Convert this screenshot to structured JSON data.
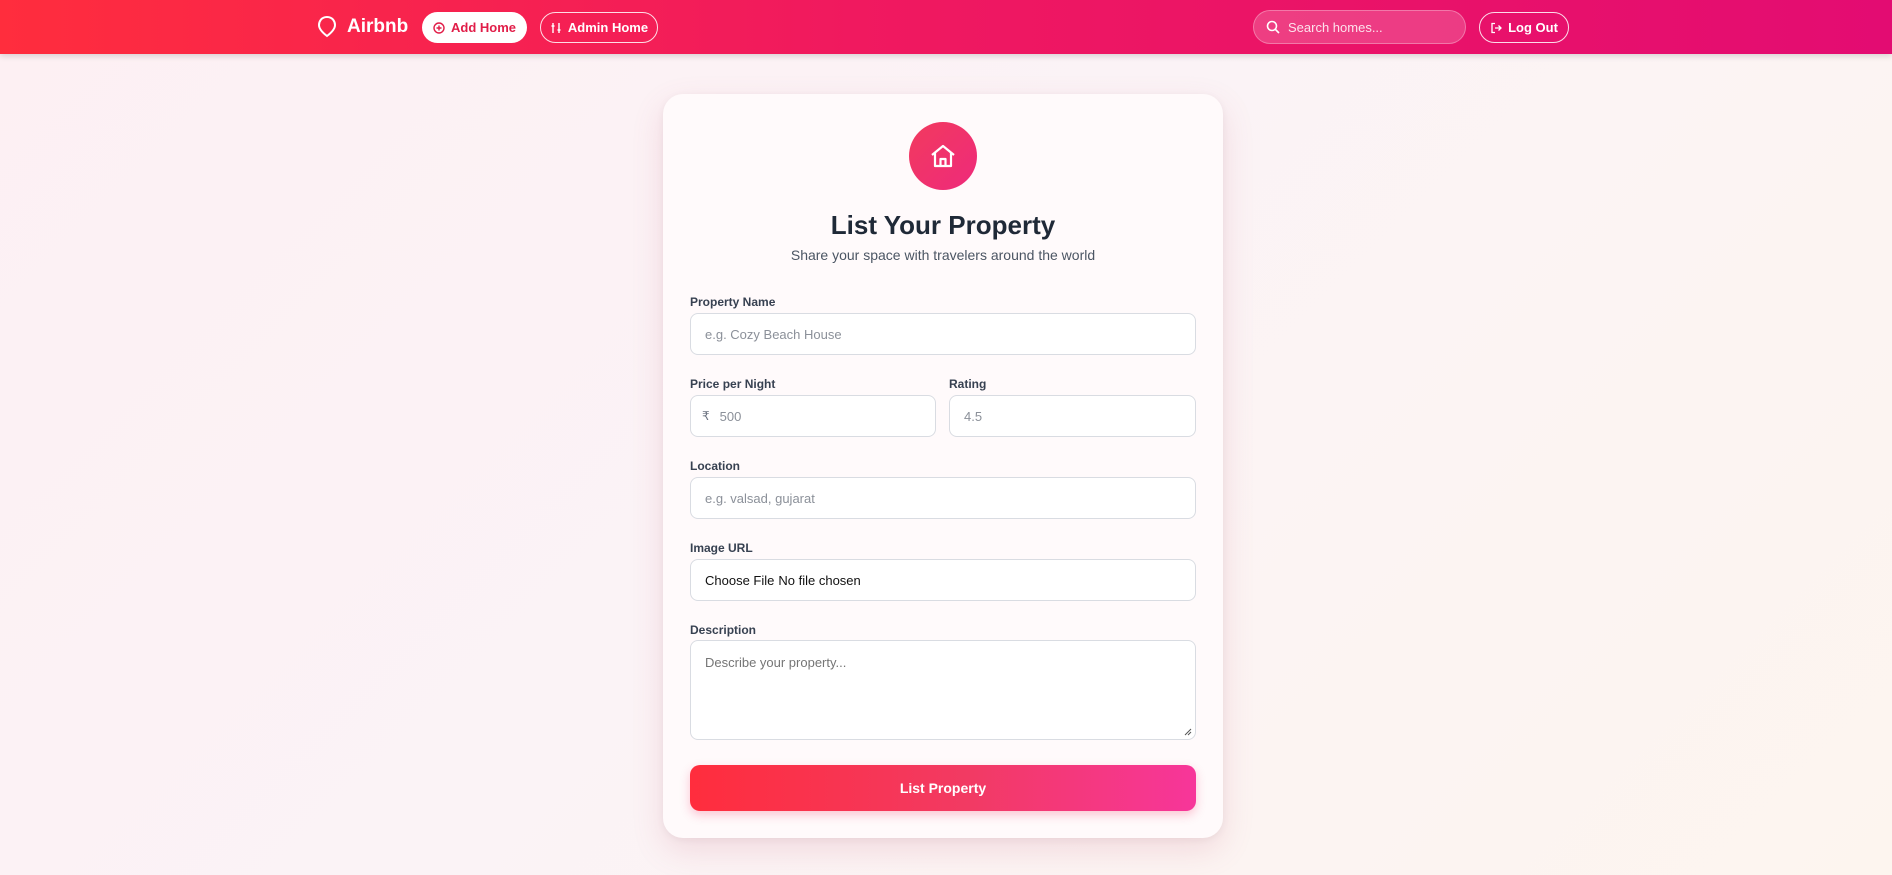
{
  "nav": {
    "brand": "Airbnb",
    "add_home": "Add Home",
    "admin_home": "Admin Home",
    "search_placeholder": "Search homes...",
    "logout": "Log Out"
  },
  "form": {
    "title": "List Your Property",
    "subtitle": "Share your space with travelers around the world",
    "property_name": {
      "label": "Property Name",
      "placeholder": "e.g. Cozy Beach House"
    },
    "price": {
      "label": "Price per Night",
      "currency": "₹",
      "placeholder": "500"
    },
    "rating": {
      "label": "Rating",
      "placeholder": "4.5"
    },
    "location": {
      "label": "Location",
      "placeholder": "e.g. valsad, gujarat"
    },
    "image": {
      "label": "Image URL",
      "button": "Choose File",
      "status": "No file chosen"
    },
    "description": {
      "label": "Description",
      "placeholder": "Describe your property..."
    },
    "submit": "List Property"
  },
  "colors": {
    "brand": "#ff385c",
    "accent": "#e11d48"
  },
  "icons": {
    "brand": "airbnb-logo-icon",
    "add": "plus-circle-icon",
    "admin": "sliders-icon",
    "search": "search-icon",
    "logout": "logout-icon",
    "home": "home-icon"
  }
}
